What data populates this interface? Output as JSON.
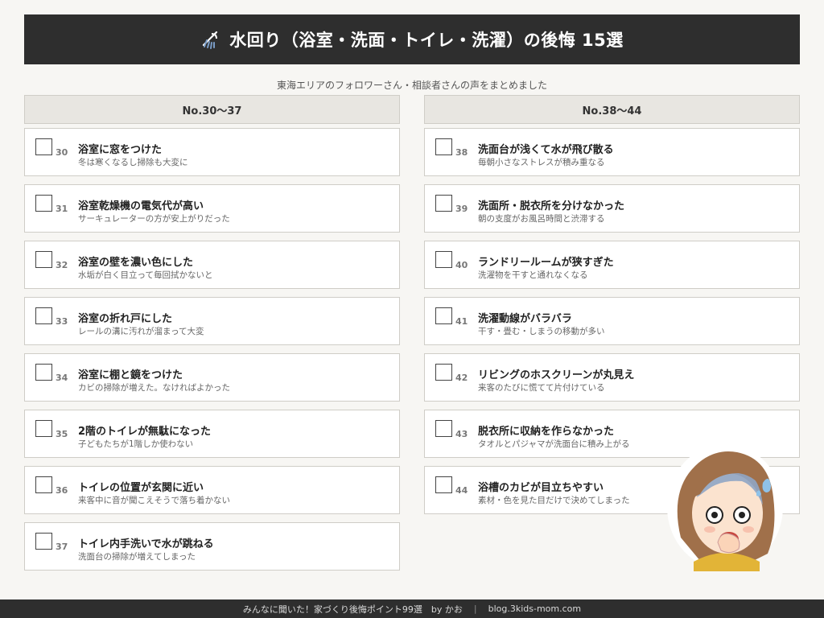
{
  "header": {
    "title": "水回り（浴室・洗面・トイレ・洗濯）の後悔 15選",
    "icon": "shower-icon"
  },
  "subtitle": "東海エリアのフォロワーさん・相談者さんの声をまとめました",
  "columns": [
    {
      "header": "No.30〜37",
      "items": [
        {
          "num": "30",
          "title": "浴室に窓をつけた",
          "desc": "冬は寒くなるし掃除も大変に"
        },
        {
          "num": "31",
          "title": "浴室乾燥機の電気代が高い",
          "desc": "サーキュレーターの方が安上がりだった"
        },
        {
          "num": "32",
          "title": "浴室の壁を濃い色にした",
          "desc": "水垢が白く目立って毎回拭かないと"
        },
        {
          "num": "33",
          "title": "浴室の折れ戸にした",
          "desc": "レールの溝に汚れが溜まって大変"
        },
        {
          "num": "34",
          "title": "浴室に棚と鏡をつけた",
          "desc": "カビの掃除が増えた。なければよかった"
        },
        {
          "num": "35",
          "title": "2階のトイレが無駄になった",
          "desc": "子どもたちが1階しか使わない"
        },
        {
          "num": "36",
          "title": "トイレの位置が玄関に近い",
          "desc": "来客中に音が聞こえそうで落ち着かない"
        },
        {
          "num": "37",
          "title": "トイレ内手洗いで水が跳ねる",
          "desc": "洗面台の掃除が増えてしまった"
        }
      ]
    },
    {
      "header": "No.38〜44",
      "items": [
        {
          "num": "38",
          "title": "洗面台が浅くて水が飛び散る",
          "desc": "毎朝小さなストレスが積み重なる"
        },
        {
          "num": "39",
          "title": "洗面所・脱衣所を分けなかった",
          "desc": "朝の支度がお風呂時間と渋滞する"
        },
        {
          "num": "40",
          "title": "ランドリールームが狭すぎた",
          "desc": "洗濯物を干すと通れなくなる"
        },
        {
          "num": "41",
          "title": "洗濯動線がバラバラ",
          "desc": "干す・畳む・しまうの移動が多い"
        },
        {
          "num": "42",
          "title": "リビングのホスクリーンが丸見え",
          "desc": "来客のたびに慌てて片付けている"
        },
        {
          "num": "43",
          "title": "脱衣所に収納を作らなかった",
          "desc": "タオルとパジャマが洗面台に積み上がる"
        },
        {
          "num": "44",
          "title": "浴槽のカビが目立ちやすい",
          "desc": "素材・色を見た目だけで決めてしまった"
        }
      ]
    }
  ],
  "footer": {
    "left": "みんなに聞いた！家づくり後悔ポイント99選　by かお",
    "separator": "|",
    "right": "blog.3kids-mom.com"
  },
  "colors": {
    "title_bg": "#2e2e2e",
    "page_bg": "#f7f6f3",
    "header_bg": "#e8e6e1",
    "border": "#cfcdc7",
    "icon_blue": "#7a9cc6"
  }
}
